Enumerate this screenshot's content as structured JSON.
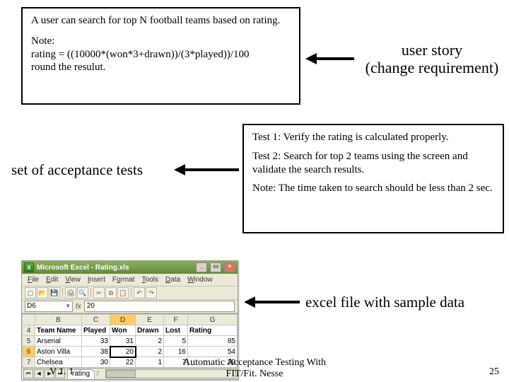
{
  "story_box": {
    "line1": "A user can search for top N football teams based on rating.",
    "note_label": "Note:",
    "formula": "rating = ((10000*(won*3+drawn))/(3*played))/100",
    "round": "round the resulut."
  },
  "story_label": {
    "l1": "user story",
    "l2": "(change requirement)"
  },
  "tests_label": "set of acceptance tests",
  "tests_box": {
    "t1": "Test 1: Verify the rating is calculated properly.",
    "t2": "Test 2: Search for top 2 teams using the screen and validate the search results.",
    "note": "Note: The time taken to search should be less than 2 sec."
  },
  "excel_label": "excel file with sample data",
  "excel": {
    "title": "Microsoft Excel - Rating.xls",
    "menu": [
      "File",
      "Edit",
      "View",
      "Insert",
      "Format",
      "Tools",
      "Data",
      "Window"
    ],
    "namebox": "D6",
    "formula_value": "20",
    "cols_blank": "",
    "cols": [
      "B",
      "C",
      "D",
      "E",
      "F",
      "G"
    ],
    "header_row": "4",
    "headers": [
      "Team Name",
      "Played",
      "Won",
      "Drawn",
      "Lost",
      "Rating"
    ],
    "rows": [
      {
        "n": "5",
        "cells": [
          "Arsenal",
          "33",
          "31",
          "2",
          "5",
          "85"
        ]
      },
      {
        "n": "6",
        "cells": [
          "Aston Villa",
          "38",
          "20",
          "2",
          "16",
          "54"
        ]
      },
      {
        "n": "7",
        "cells": [
          "Chelsea",
          "30",
          "22",
          "1",
          "7",
          "29"
        ]
      }
    ],
    "tab": "rating"
  },
  "footer": {
    "left": "V 1. 1",
    "center1": "Automatic Acceptance Testing With",
    "center2": "FIT/Fit. Nesse",
    "right": "25"
  }
}
